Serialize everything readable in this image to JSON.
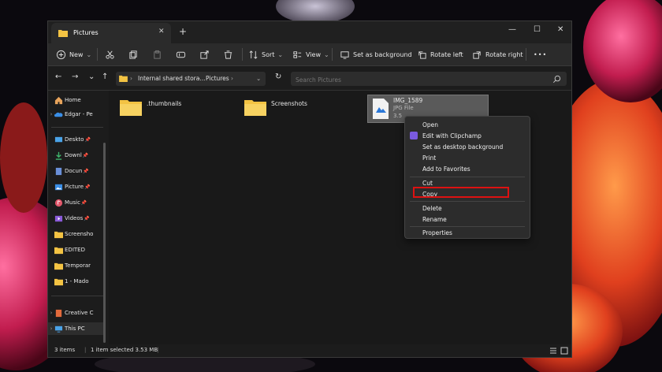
{
  "window": {
    "tab_title": "Pictures",
    "tab_close": "✕",
    "new_tab": "+",
    "controls": [
      "—",
      "☐",
      "✕"
    ]
  },
  "commandbar": {
    "new_label": "New",
    "sort_label": "Sort",
    "view_label": "View",
    "set_bg_label": "Set as background",
    "rotate_left_label": "Rotate left",
    "rotate_right_label": "Rotate right",
    "more_label": "•••"
  },
  "address": {
    "crumb1": "Internal shared stora...",
    "crumb2": "Pictures",
    "sep": "›"
  },
  "search": {
    "placeholder": "Search Pictures"
  },
  "sidebar": {
    "items": [
      {
        "label": "Home",
        "icon": "home-icon"
      },
      {
        "label": "Edgar - Pe",
        "icon": "cloud-icon"
      },
      {
        "label": "Deskto",
        "icon": "desktop-icon"
      },
      {
        "label": "Downl",
        "icon": "download-icon"
      },
      {
        "label": "Docun",
        "icon": "document-icon"
      },
      {
        "label": "Picture",
        "icon": "pictures-icon"
      },
      {
        "label": "Music",
        "icon": "music-icon"
      },
      {
        "label": "Videos",
        "icon": "videos-icon"
      },
      {
        "label": "Screensho",
        "icon": "folder-icon"
      },
      {
        "label": "EDITED",
        "icon": "folder-icon"
      },
      {
        "label": "Temporar",
        "icon": "folder-icon"
      },
      {
        "label": "1 - Mado",
        "icon": "folder-icon"
      },
      {
        "label": "Creative C",
        "icon": "creative-cloud-icon"
      },
      {
        "label": "This PC",
        "icon": "pc-icon"
      }
    ]
  },
  "files": [
    {
      "name": ".thumbnails",
      "type": "folder"
    },
    {
      "name": "Screenshots",
      "type": "folder"
    },
    {
      "name": "IMG_1589",
      "type": "JPG File",
      "size": "3.5"
    }
  ],
  "context_menu": {
    "open": "Open",
    "edit_clipchamp": "Edit with Clipchamp",
    "set_desktop_bg": "Set as desktop background",
    "print": "Print",
    "add_favorites": "Add to Favorites",
    "cut": "Cut",
    "copy": "Copy",
    "delete": "Delete",
    "rename": "Rename",
    "properties": "Properties"
  },
  "status": {
    "items_count": "3 items",
    "selected": "1 item selected  3.53 MB"
  },
  "colors": {
    "highlight_box": "#dd1111",
    "folder": "#f3c343",
    "window_bg": "#1c1c1c"
  }
}
